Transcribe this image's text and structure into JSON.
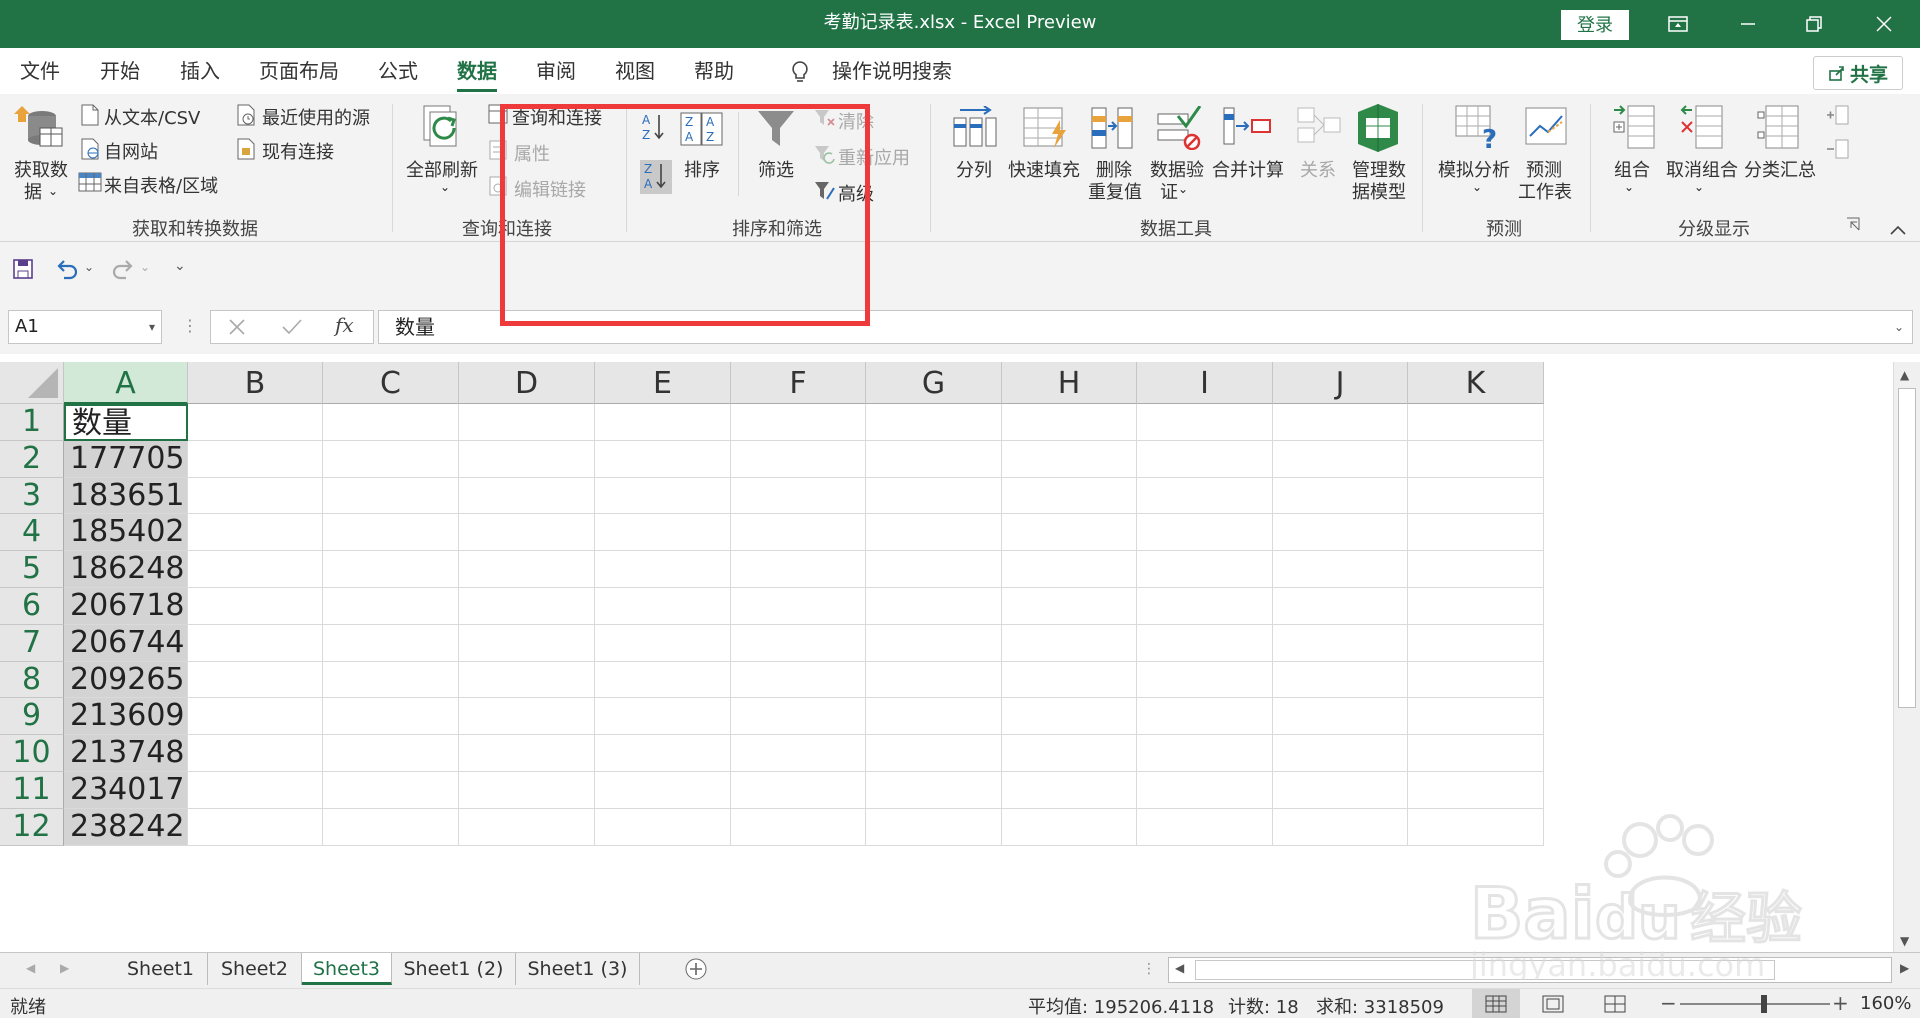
{
  "window": {
    "title": "考勤记录表.xlsx  -  Excel Preview",
    "login_label": "登录"
  },
  "menu": {
    "tabs": [
      "文件",
      "开始",
      "插入",
      "页面布局",
      "公式",
      "数据",
      "审阅",
      "视图",
      "帮助"
    ],
    "active": "数据",
    "search_label": "操作说明搜索",
    "share_label": "共享"
  },
  "ribbon": {
    "get_data": {
      "big_label_1": "获取数",
      "big_label_2": "据",
      "from_text": "从文本/CSV",
      "from_web": "自网站",
      "from_table": "来自表格/区域",
      "recent_sources": "最近使用的源",
      "existing_conn": "现有连接",
      "group_title": "获取和转换数据"
    },
    "queries": {
      "refresh_all": "全部刷新",
      "queries_conn": "查询和连接",
      "properties": "属性",
      "edit_links": "编辑链接",
      "group_title": "查询和连接"
    },
    "sort_filter": {
      "sort": "排序",
      "filter": "筛选",
      "clear": "清除",
      "reapply": "重新应用",
      "advanced": "高级",
      "group_title": "排序和筛选"
    },
    "data_tools": {
      "text_to_cols": "分列",
      "flash_fill": "快速填充",
      "remove_dup_1": "删除",
      "remove_dup_2": "重复值",
      "validation_1": "数据验",
      "validation_2": "证",
      "consolidate": "合并计算",
      "relations": "关系",
      "data_model_1": "管理数",
      "data_model_2": "据模型",
      "group_title": "数据工具"
    },
    "forecast": {
      "what_if": "模拟分析",
      "forecast_1": "预测",
      "forecast_2": "工作表",
      "group_title": "预测"
    },
    "outline": {
      "group": "组合",
      "ungroup": "取消组合",
      "subtotal": "分类汇总",
      "group_title": "分级显示"
    }
  },
  "formula_bar": {
    "name_box": "A1",
    "fx": "fx",
    "content": "数量"
  },
  "sheet": {
    "columns": [
      "A",
      "B",
      "C",
      "D",
      "E",
      "F",
      "G",
      "H",
      "I",
      "J",
      "K"
    ],
    "rows": [
      "1",
      "2",
      "3",
      "4",
      "5",
      "6",
      "7",
      "8",
      "9",
      "10",
      "11",
      "12"
    ],
    "col_a_values": [
      "数量",
      "177705",
      "183651",
      "185402",
      "186248",
      "206718",
      "206744",
      "209265",
      "213609",
      "213748",
      "234017",
      "238242"
    ]
  },
  "tabs": [
    "Sheet1",
    "Sheet2",
    "Sheet3",
    "Sheet1 (2)",
    "Sheet1 (3)"
  ],
  "active_tab": "Sheet3",
  "status": {
    "ready": "就绪",
    "average": "平均值: 195206.4118",
    "count": "计数: 18",
    "sum": "求和: 3318509",
    "zoom": "160%"
  },
  "colors": {
    "brand": "#217346",
    "highlight": "#ee3a3a"
  }
}
